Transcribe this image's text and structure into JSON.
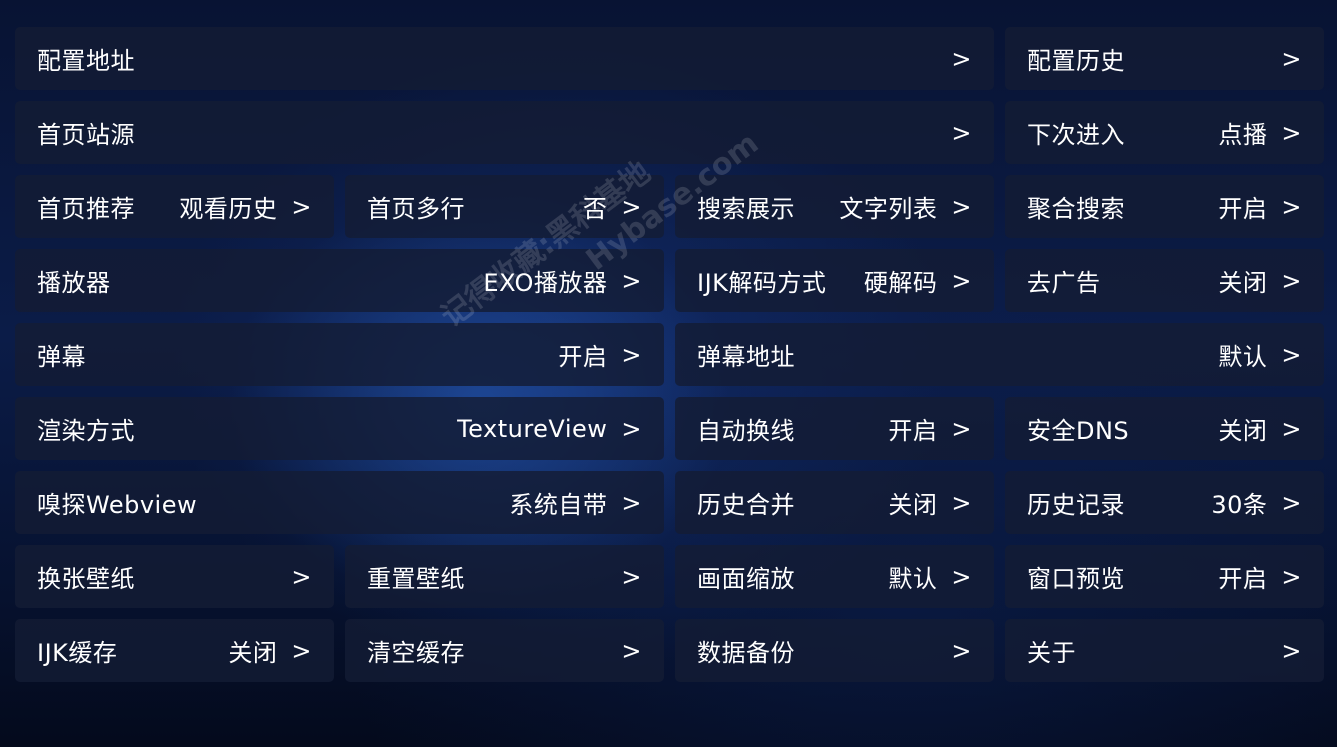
{
  "chevron": ">",
  "watermark": {
    "line1": "记得收藏:黑科基地",
    "line2": "Hybase.com"
  },
  "settings": [
    {
      "label": "配置地址",
      "value": "",
      "span": 3,
      "name": "setting-config-address"
    },
    {
      "label": "配置历史",
      "value": "",
      "span": 1,
      "name": "setting-config-history"
    },
    {
      "label": "首页站源",
      "value": "",
      "span": 3,
      "name": "setting-home-source"
    },
    {
      "label": "下次进入",
      "value": "点播",
      "span": 1,
      "name": "setting-next-entry"
    },
    {
      "label": "首页推荐",
      "value": "观看历史",
      "span": 1,
      "name": "setting-home-recommend"
    },
    {
      "label": "首页多行",
      "value": "否",
      "span": 1,
      "name": "setting-home-multirow"
    },
    {
      "label": "搜索展示",
      "value": "文字列表",
      "span": 1,
      "name": "setting-search-display"
    },
    {
      "label": "聚合搜索",
      "value": "开启",
      "span": 1,
      "name": "setting-aggregate-search"
    },
    {
      "label": "播放器",
      "value": "EXO播放器",
      "span": 2,
      "name": "setting-player"
    },
    {
      "label": "IJK解码方式",
      "value": "硬解码",
      "span": 1,
      "name": "setting-ijk-decode"
    },
    {
      "label": "去广告",
      "value": "关闭",
      "span": 1,
      "name": "setting-ad-block"
    },
    {
      "label": "弹幕",
      "value": "开启",
      "span": 2,
      "name": "setting-danmaku"
    },
    {
      "label": "弹幕地址",
      "value": "默认",
      "span": 2,
      "name": "setting-danmaku-address"
    },
    {
      "label": "渲染方式",
      "value": "TextureView",
      "span": 2,
      "name": "setting-render-mode"
    },
    {
      "label": "自动换线",
      "value": "开启",
      "span": 1,
      "name": "setting-auto-switch-line"
    },
    {
      "label": "安全DNS",
      "value": "关闭",
      "span": 1,
      "name": "setting-secure-dns"
    },
    {
      "label": "嗅探Webview",
      "value": "系统自带",
      "span": 2,
      "name": "setting-sniff-webview"
    },
    {
      "label": "历史合并",
      "value": "关闭",
      "span": 1,
      "name": "setting-history-merge"
    },
    {
      "label": "历史记录",
      "value": "30条",
      "span": 1,
      "name": "setting-history-records"
    },
    {
      "label": "换张壁纸",
      "value": "",
      "span": 1,
      "name": "setting-change-wallpaper"
    },
    {
      "label": "重置壁纸",
      "value": "",
      "span": 1,
      "name": "setting-reset-wallpaper"
    },
    {
      "label": "画面缩放",
      "value": "默认",
      "span": 1,
      "name": "setting-screen-scale"
    },
    {
      "label": "窗口预览",
      "value": "开启",
      "span": 1,
      "name": "setting-window-preview"
    },
    {
      "label": "IJK缓存",
      "value": "关闭",
      "span": 1,
      "name": "setting-ijk-cache"
    },
    {
      "label": "清空缓存",
      "value": "",
      "span": 1,
      "name": "setting-clear-cache"
    },
    {
      "label": "数据备份",
      "value": "",
      "span": 1,
      "name": "setting-data-backup"
    },
    {
      "label": "关于",
      "value": "",
      "span": 1,
      "name": "setting-about"
    }
  ]
}
